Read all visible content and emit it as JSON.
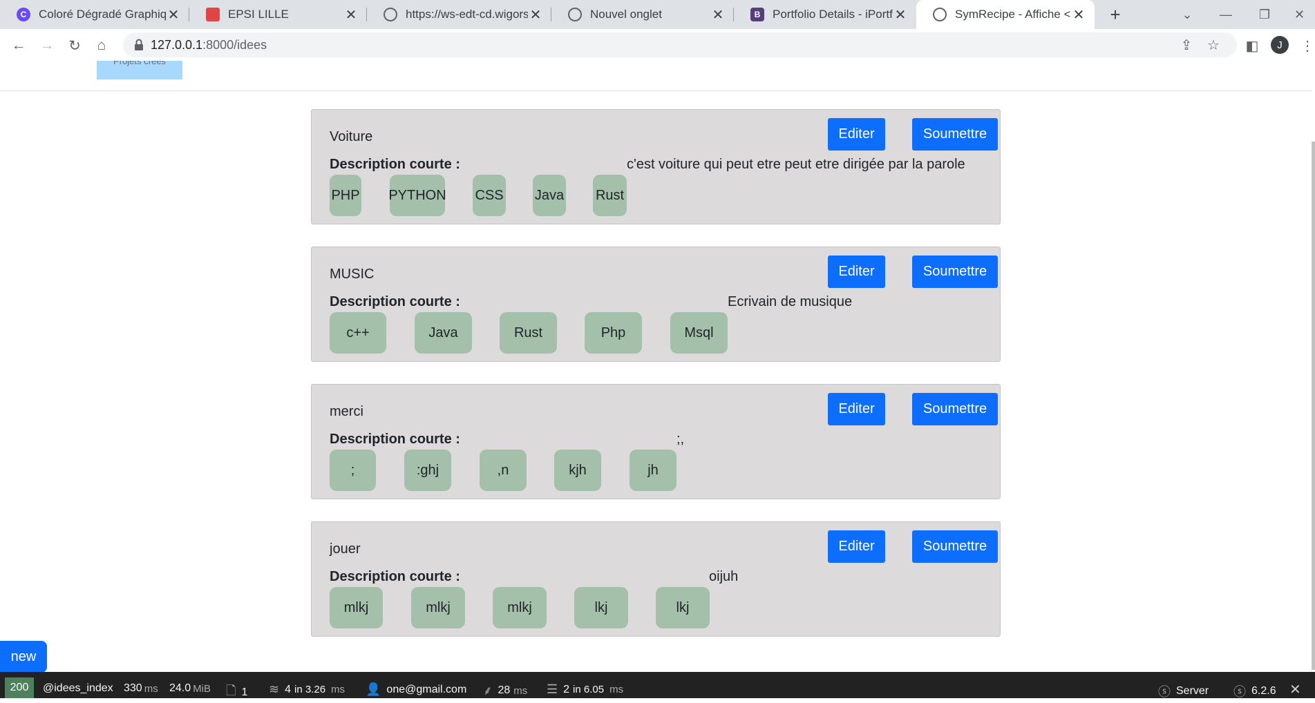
{
  "browser": {
    "tabs": [
      {
        "title": "Coloré Dégradé Graphique",
        "favicon_color": "#6c4cf2",
        "active": false
      },
      {
        "title": "EPSI LILLE",
        "favicon_color": "#e04646",
        "active": false
      },
      {
        "title": "https://ws-edt-cd.wigorserv",
        "favicon_color": "#5f6368",
        "active": false
      },
      {
        "title": "Nouvel onglet",
        "favicon_color": "#5f6368",
        "active": false
      },
      {
        "title": "Portfolio Details - iPortfolio",
        "favicon_color": "#563d7c",
        "active": false
      },
      {
        "title": "SymRecipe - Affiche <link r",
        "favicon_color": "#5f6368",
        "active": true
      }
    ],
    "url_host": "127.0.0.1",
    "url_path": ":8000/idees",
    "profile_initial": "J"
  },
  "page": {
    "partial_top_button": "Projets créés",
    "edit_label": "Editer",
    "submit_label": "Soumettre",
    "description_label": "Description courte :",
    "new_label": "new",
    "ideas": [
      {
        "name": "Voiture",
        "description": "c'est voiture qui peut etre peut etre dirigée par la parole",
        "tags": [
          "PHP",
          "PYTHON",
          "CSS",
          "Java",
          "Rust"
        ]
      },
      {
        "name": "MUSIC",
        "description": "Ecrivain de musique",
        "tags": [
          "c++",
          "Java",
          "Rust",
          "Php",
          "Msql"
        ]
      },
      {
        "name": "merci",
        "description": ";,",
        "tags": [
          ";",
          ":ghj",
          ",n",
          "kjh",
          "jh"
        ]
      },
      {
        "name": "jouer",
        "description": "oijuh",
        "tags": [
          "mlkj",
          "mlkj",
          "mlkj",
          "lkj",
          "lkj"
        ]
      }
    ]
  },
  "debug_toolbar": {
    "status_code": "200",
    "route": "@idees_index",
    "time_value": "330",
    "time_unit": "ms",
    "memory_value": "24.0",
    "memory_unit": "MiB",
    "forms_count": "1",
    "cache_calls": "4",
    "cache_in": "in 3.26",
    "cache_unit": "ms",
    "user": "one@gmail.com",
    "twig_time": "28",
    "twig_unit": "ms",
    "db_queries": "2",
    "db_in": "in 6.05",
    "db_unit": "ms",
    "server_label": "Server",
    "version": "6.2.6"
  }
}
